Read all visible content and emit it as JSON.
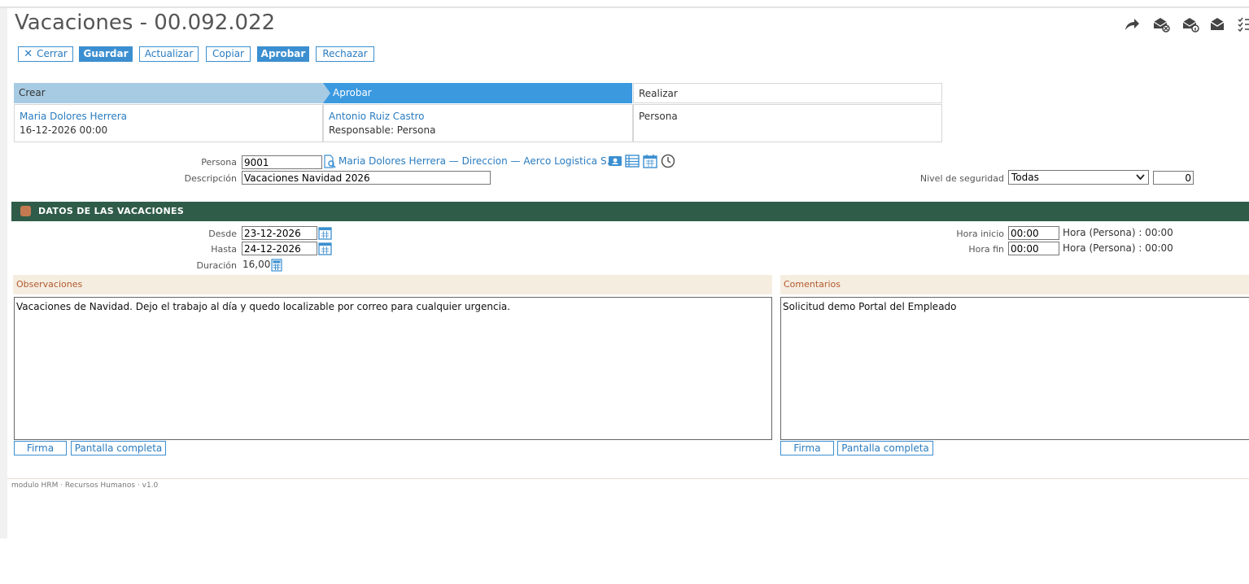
{
  "header": {
    "title": "Vacaciones - 00.092.022"
  },
  "top_icons": [
    "share-icon",
    "mail-remove-icon",
    "mail-info-icon",
    "mail-open-icon",
    "checklist-icon"
  ],
  "toolbar": {
    "cerrar": "Cerrar",
    "guardar": "Guardar",
    "actualizar": "Actualizar",
    "copiar": "Copiar",
    "aprobar": "Aprobar",
    "rechazar": "Rechazar"
  },
  "workflow": {
    "steps": [
      {
        "label": "Crear",
        "link": "Maria Dolores Herrera",
        "detail": "16-12-2026 00:00"
      },
      {
        "label": "Aprobar",
        "link": "Antonio Ruiz Castro",
        "detail": "Responsable: Persona"
      },
      {
        "label": "Realizar",
        "detail": "Persona"
      }
    ]
  },
  "form": {
    "persona_label": "Persona",
    "persona_value": "9001",
    "persona_link": "Maria Dolores Herrera — Direccion — Aerco Logistica S.A.",
    "descripcion_label": "Descripción",
    "descripcion_value": "Vacaciones Navidad 2026",
    "nivel_label": "Nivel de seguridad",
    "nivel_value": "Todas",
    "nivel_number": "0"
  },
  "section": {
    "title": "DATOS DE LAS VACACIONES",
    "desde_label": "Desde",
    "desde_value": "23-12-2026",
    "hasta_label": "Hasta",
    "hasta_value": "24-12-2026",
    "duracion_label": "Duración",
    "duracion_value": "16,00",
    "hora_inicio_label": "Hora inicio",
    "hora_inicio_value": "00:00",
    "hora_inicio_info": "Hora (Persona) : 00:00",
    "hora_fin_label": "Hora fin",
    "hora_fin_value": "00:00",
    "hora_fin_info": "Hora (Persona) : 00:00"
  },
  "observaciones": {
    "label": "Observaciones",
    "text": "Vacaciones de Navidad. Dejo el trabajo al día y quedo localizable por correo para cualquier urgencia.",
    "firma": "Firma",
    "pantalla": "Pantalla completa"
  },
  "comentarios": {
    "label": "Comentarios",
    "text": "Solicitud demo Portal del Empleado",
    "firma": "Firma",
    "pantalla": "Pantalla completa"
  },
  "footer": {
    "text": "modulo HRM · Recursos Humanos · v1.0"
  },
  "colors": {
    "accent": "#3b8fd0",
    "section": "#2f5c48",
    "crear_header": "#a8cbe4",
    "panel_header": "#f6ede1"
  }
}
